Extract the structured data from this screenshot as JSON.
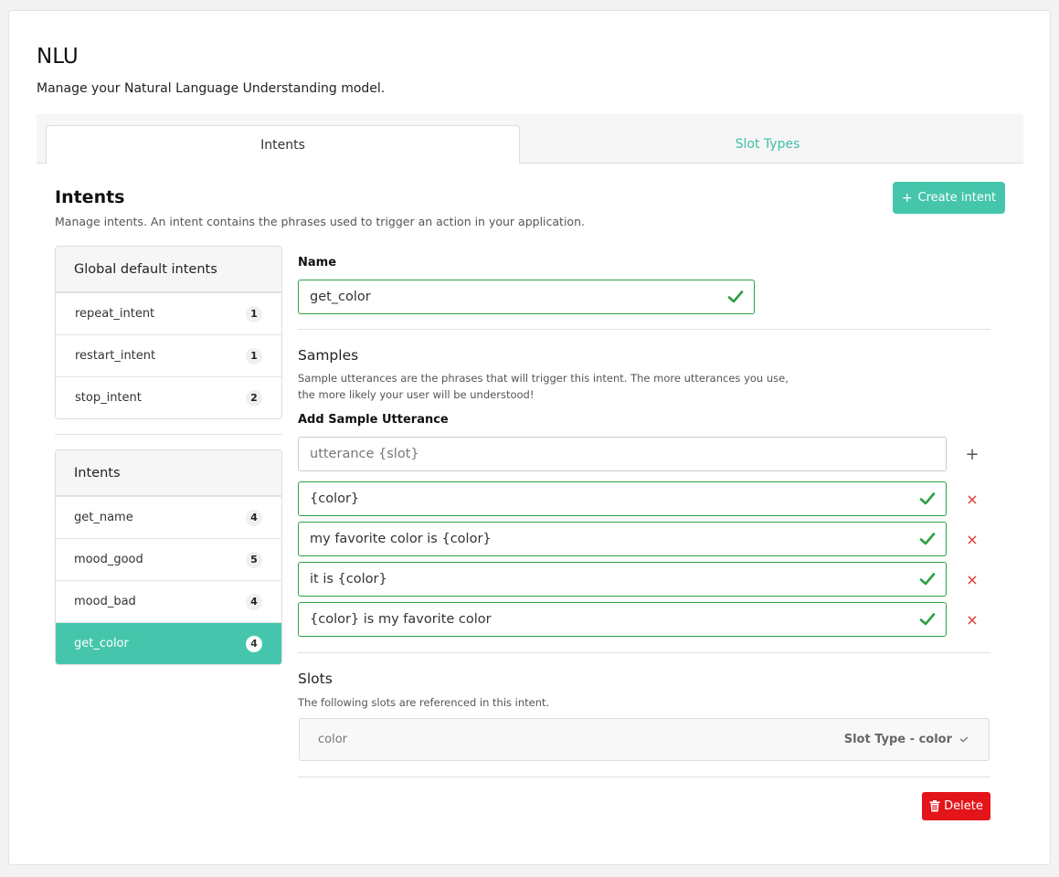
{
  "page": {
    "title": "NLU",
    "subtitle": "Manage your Natural Language Understanding model."
  },
  "tabs": [
    {
      "label": "Intents",
      "active": true
    },
    {
      "label": "Slot Types",
      "active": false
    }
  ],
  "section": {
    "title": "Intents",
    "subtitle": "Manage intents. An intent contains the phrases used to trigger an action in your application.",
    "create_label": "Create intent"
  },
  "global_intents": {
    "header": "Global default intents",
    "items": [
      {
        "name": "repeat_intent",
        "count": "1"
      },
      {
        "name": "restart_intent",
        "count": "1"
      },
      {
        "name": "stop_intent",
        "count": "2"
      }
    ]
  },
  "intents": {
    "header": "Intents",
    "items": [
      {
        "name": "get_name",
        "count": "4"
      },
      {
        "name": "mood_good",
        "count": "5"
      },
      {
        "name": "mood_bad",
        "count": "4"
      },
      {
        "name": "get_color",
        "count": "4",
        "selected": true
      }
    ]
  },
  "form": {
    "name_label": "Name",
    "name_value": "get_color",
    "samples_title": "Samples",
    "samples_desc_1": "Sample utterances are the phrases that will trigger this intent. The more utterances you use,",
    "samples_desc_2": "the more likely your user will be understood!",
    "add_sample_label": "Add Sample Utterance",
    "add_sample_placeholder": "utterance {slot}",
    "samples": [
      "{color}",
      "my favorite color is {color}",
      "it is {color}",
      "{color} is my favorite color"
    ],
    "slots_title": "Slots",
    "slots_desc": "The following slots are referenced in this intent.",
    "slots": [
      {
        "name": "color",
        "type_label": "Slot Type - color"
      }
    ],
    "delete_label": "Delete"
  },
  "colors": {
    "accent": "#45c6ac",
    "valid": "#2e9e44",
    "danger": "#e3141a"
  }
}
